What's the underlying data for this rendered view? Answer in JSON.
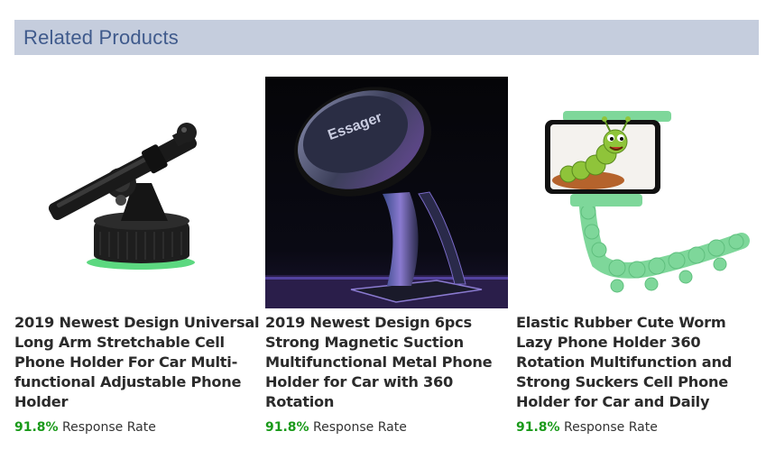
{
  "section": {
    "title": "Related Products"
  },
  "products": [
    {
      "title": "2019 Newest Design Universal Long Arm Stretchable Cell Phone Holder For Car Multi-functional Adjustable Phone Holder",
      "rate_value": "91.8%",
      "rate_label": "Response Rate",
      "image": "long-arm-suction-phone-holder"
    },
    {
      "title": "2019 Newest Design 6pcs Strong Magnetic Suction Multifunctional Metal Phone Holder for Car with 360 Rotation",
      "rate_value": "91.8%",
      "rate_label": "Response Rate",
      "image": "magnetic-phone-holder",
      "image_text": "Essager"
    },
    {
      "title": "Elastic Rubber Cute Worm Lazy Phone Holder 360 Rotation Multifunction and Strong Suckers Cell Phone Holder for Car and Daily",
      "rate_value": "91.8%",
      "rate_label": "Response Rate",
      "image": "worm-phone-holder"
    }
  ],
  "colors": {
    "header_bg": "#c5cddd",
    "header_text": "#3f5a8c",
    "rate_green": "#1a9a1a"
  }
}
